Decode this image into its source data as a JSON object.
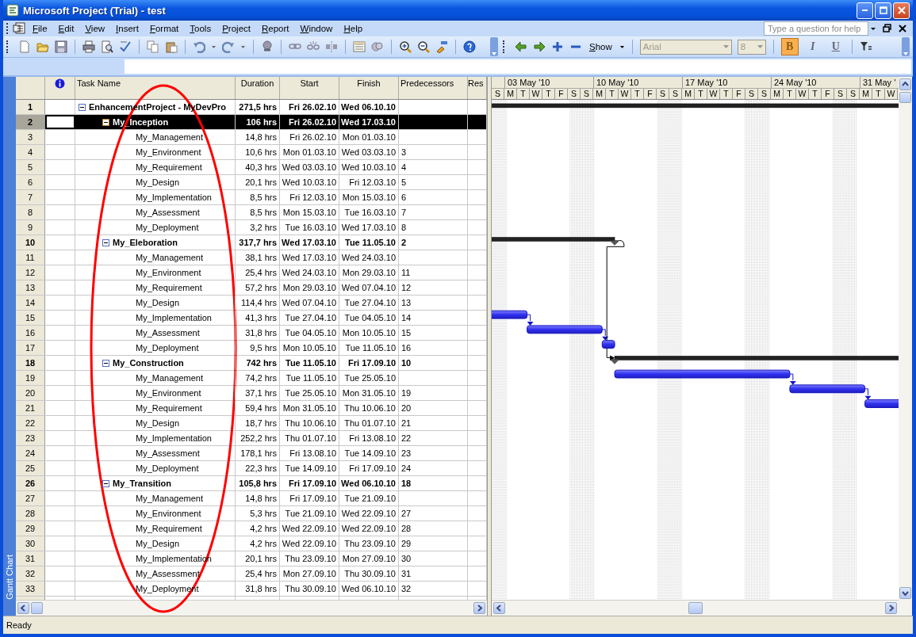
{
  "window": {
    "title": "Microsoft Project (Trial) - test"
  },
  "menu": [
    {
      "label": "File"
    },
    {
      "label": "Edit"
    },
    {
      "label": "View"
    },
    {
      "label": "Insert"
    },
    {
      "label": "Format"
    },
    {
      "label": "Tools"
    },
    {
      "label": "Project"
    },
    {
      "label": "Report"
    },
    {
      "label": "Window"
    },
    {
      "label": "Help"
    }
  ],
  "help_box": {
    "placeholder": "Type a question for help"
  },
  "toolbar": {
    "show_label": "Show",
    "font": "Arial",
    "size": "8",
    "format_buttons": [
      {
        "label": "B",
        "on": true
      },
      {
        "label": "I",
        "on": false
      },
      {
        "label": "U",
        "on": false
      }
    ]
  },
  "view_bar": {
    "label": "Gantt Chart"
  },
  "table": {
    "columns": [
      "Task Name",
      "Duration",
      "Start",
      "Finish",
      "Predecessors",
      "Res"
    ],
    "rows": [
      {
        "id": "1",
        "name": "EnhancementProject - MyDevPro",
        "duration": "271,5 hrs",
        "start": "Fri 26.02.10",
        "finish": "Wed 06.10.10",
        "expanded": true,
        "selected": false,
        "children": [
          {
            "id": "2",
            "name": "My_Inception",
            "duration": "106 hrs",
            "start": "Fri 26.02.10",
            "finish": "Wed 17.03.10",
            "expanded": true,
            "selected": true,
            "children": [
              {
                "id": "3",
                "name": "My_Management",
                "duration": "14,8 hrs",
                "start": "Fri 26.02.10",
                "finish": "Mon 01.03.10",
                "selected": false
              },
              {
                "id": "4",
                "name": "My_Environment",
                "duration": "10,6 hrs",
                "start": "Mon 01.03.10",
                "finish": "Wed 03.03.10",
                "predecessors": "3",
                "selected": false
              },
              {
                "id": "5",
                "name": "My_Requirement",
                "duration": "40,3 hrs",
                "start": "Wed 03.03.10",
                "finish": "Wed 10.03.10",
                "predecessors": "4",
                "selected": false
              },
              {
                "id": "6",
                "name": "My_Design",
                "duration": "20,1 hrs",
                "start": "Wed 10.03.10",
                "finish": "Fri 12.03.10",
                "predecessors": "5",
                "selected": false
              },
              {
                "id": "7",
                "name": "My_Implementation",
                "duration": "8,5 hrs",
                "start": "Fri 12.03.10",
                "finish": "Mon 15.03.10",
                "predecessors": "6",
                "selected": false
              },
              {
                "id": "8",
                "name": "My_Assessment",
                "duration": "8,5 hrs",
                "start": "Mon 15.03.10",
                "finish": "Tue 16.03.10",
                "predecessors": "7",
                "selected": false
              },
              {
                "id": "9",
                "name": "My_Deployment",
                "duration": "3,2 hrs",
                "start": "Tue 16.03.10",
                "finish": "Wed 17.03.10",
                "predecessors": "8",
                "selected": false
              }
            ]
          },
          {
            "id": "10",
            "name": "My_Eleboration",
            "duration": "317,7 hrs",
            "start": "Wed 17.03.10",
            "finish": "Tue 11.05.10",
            "predecessors": "2",
            "expanded": true,
            "selected": false,
            "children": [
              {
                "id": "11",
                "name": "My_Management",
                "duration": "38,1 hrs",
                "start": "Wed 17.03.10",
                "finish": "Wed 24.03.10",
                "selected": false
              },
              {
                "id": "12",
                "name": "My_Environment",
                "duration": "25,4 hrs",
                "start": "Wed 24.03.10",
                "finish": "Mon 29.03.10",
                "predecessors": "11",
                "selected": false
              },
              {
                "id": "13",
                "name": "My_Requirement",
                "duration": "57,2 hrs",
                "start": "Mon 29.03.10",
                "finish": "Wed 07.04.10",
                "predecessors": "12",
                "selected": false
              },
              {
                "id": "14",
                "name": "My_Design",
                "duration": "114,4 hrs",
                "start": "Wed 07.04.10",
                "finish": "Tue 27.04.10",
                "predecessors": "13",
                "selected": false
              },
              {
                "id": "15",
                "name": "My_Implementation",
                "duration": "41,3 hrs",
                "start": "Tue 27.04.10",
                "finish": "Tue 04.05.10",
                "predecessors": "14",
                "selected": false
              },
              {
                "id": "16",
                "name": "My_Assessment",
                "duration": "31,8 hrs",
                "start": "Tue 04.05.10",
                "finish": "Mon 10.05.10",
                "predecessors": "15",
                "selected": false
              },
              {
                "id": "17",
                "name": "My_Deployment",
                "duration": "9,5 hrs",
                "start": "Mon 10.05.10",
                "finish": "Tue 11.05.10",
                "predecessors": "16",
                "selected": false
              }
            ]
          },
          {
            "id": "18",
            "name": "My_Construction",
            "duration": "742 hrs",
            "start": "Tue 11.05.10",
            "finish": "Fri 17.09.10",
            "predecessors": "10",
            "expanded": true,
            "selected": false,
            "children": [
              {
                "id": "19",
                "name": "My_Management",
                "duration": "74,2 hrs",
                "start": "Tue 11.05.10",
                "finish": "Tue 25.05.10",
                "selected": false
              },
              {
                "id": "20",
                "name": "My_Environment",
                "duration": "37,1 hrs",
                "start": "Tue 25.05.10",
                "finish": "Mon 31.05.10",
                "predecessors": "19",
                "selected": false
              },
              {
                "id": "21",
                "name": "My_Requirement",
                "duration": "59,4 hrs",
                "start": "Mon 31.05.10",
                "finish": "Thu 10.06.10",
                "predecessors": "20",
                "selected": false
              },
              {
                "id": "22",
                "name": "My_Design",
                "duration": "18,7 hrs",
                "start": "Thu 10.06.10",
                "finish": "Thu 01.07.10",
                "predecessors": "21",
                "selected": false
              },
              {
                "id": "23",
                "name": "My_Implementation",
                "duration": "252,2 hrs",
                "start": "Thu 01.07.10",
                "finish": "Fri 13.08.10",
                "predecessors": "22",
                "selected": false
              },
              {
                "id": "24",
                "name": "My_Assessment",
                "duration": "178,1 hrs",
                "start": "Fri 13.08.10",
                "finish": "Tue 14.09.10",
                "predecessors": "23",
                "selected": false
              },
              {
                "id": "25",
                "name": "My_Deployment",
                "duration": "22,3 hrs",
                "start": "Tue 14.09.10",
                "finish": "Fri 17.09.10",
                "predecessors": "24",
                "selected": false
              }
            ]
          },
          {
            "id": "26",
            "name": "My_Transition",
            "duration": "105,8 hrs",
            "start": "Fri 17.09.10",
            "finish": "Wed 06.10.10",
            "predecessors": "18",
            "expanded": true,
            "selected": false,
            "children": [
              {
                "id": "27",
                "name": "My_Management",
                "duration": "14,8 hrs",
                "start": "Fri 17.09.10",
                "finish": "Tue 21.09.10",
                "selected": false
              },
              {
                "id": "28",
                "name": "My_Environment",
                "duration": "5,3 hrs",
                "start": "Tue 21.09.10",
                "finish": "Wed 22.09.10",
                "predecessors": "27",
                "selected": false
              },
              {
                "id": "29",
                "name": "My_Requirement",
                "duration": "4,2 hrs",
                "start": "Wed 22.09.10",
                "finish": "Wed 22.09.10",
                "predecessors": "28",
                "selected": false
              },
              {
                "id": "30",
                "name": "My_Design",
                "duration": "4,2 hrs",
                "start": "Wed 22.09.10",
                "finish": "Thu 23.09.10",
                "predecessors": "29",
                "selected": false
              },
              {
                "id": "31",
                "name": "My_Implementation",
                "duration": "20,1 hrs",
                "start": "Thu 23.09.10",
                "finish": "Mon 27.09.10",
                "predecessors": "30",
                "selected": false
              },
              {
                "id": "32",
                "name": "My_Assessment",
                "duration": "25,4 hrs",
                "start": "Mon 27.09.10",
                "finish": "Thu 30.09.10",
                "predecessors": "31",
                "selected": false
              },
              {
                "id": "33",
                "name": "My_Deployment",
                "duration": "31,8 hrs",
                "start": "Thu 30.09.10",
                "finish": "Wed 06.10.10",
                "predecessors": "32",
                "selected": false
              }
            ]
          }
        ]
      }
    ]
  },
  "timescale": {
    "weeks": [
      "03 May '10",
      "10 May '10",
      "17 May '10",
      "24 May '10",
      "31 May '"
    ],
    "days": [
      "S",
      "M",
      "T",
      "W",
      "T",
      "F",
      "S",
      "S",
      "M",
      "T",
      "W",
      "T",
      "F",
      "S",
      "S",
      "M",
      "T",
      "W",
      "T",
      "F",
      "S",
      "S",
      "M",
      "T",
      "W",
      "T",
      "F",
      "S",
      "S",
      "M",
      "T",
      "W"
    ]
  },
  "status_bar": {
    "text": "Ready"
  },
  "annotations": [
    {
      "kind": "ellipse"
    }
  ]
}
